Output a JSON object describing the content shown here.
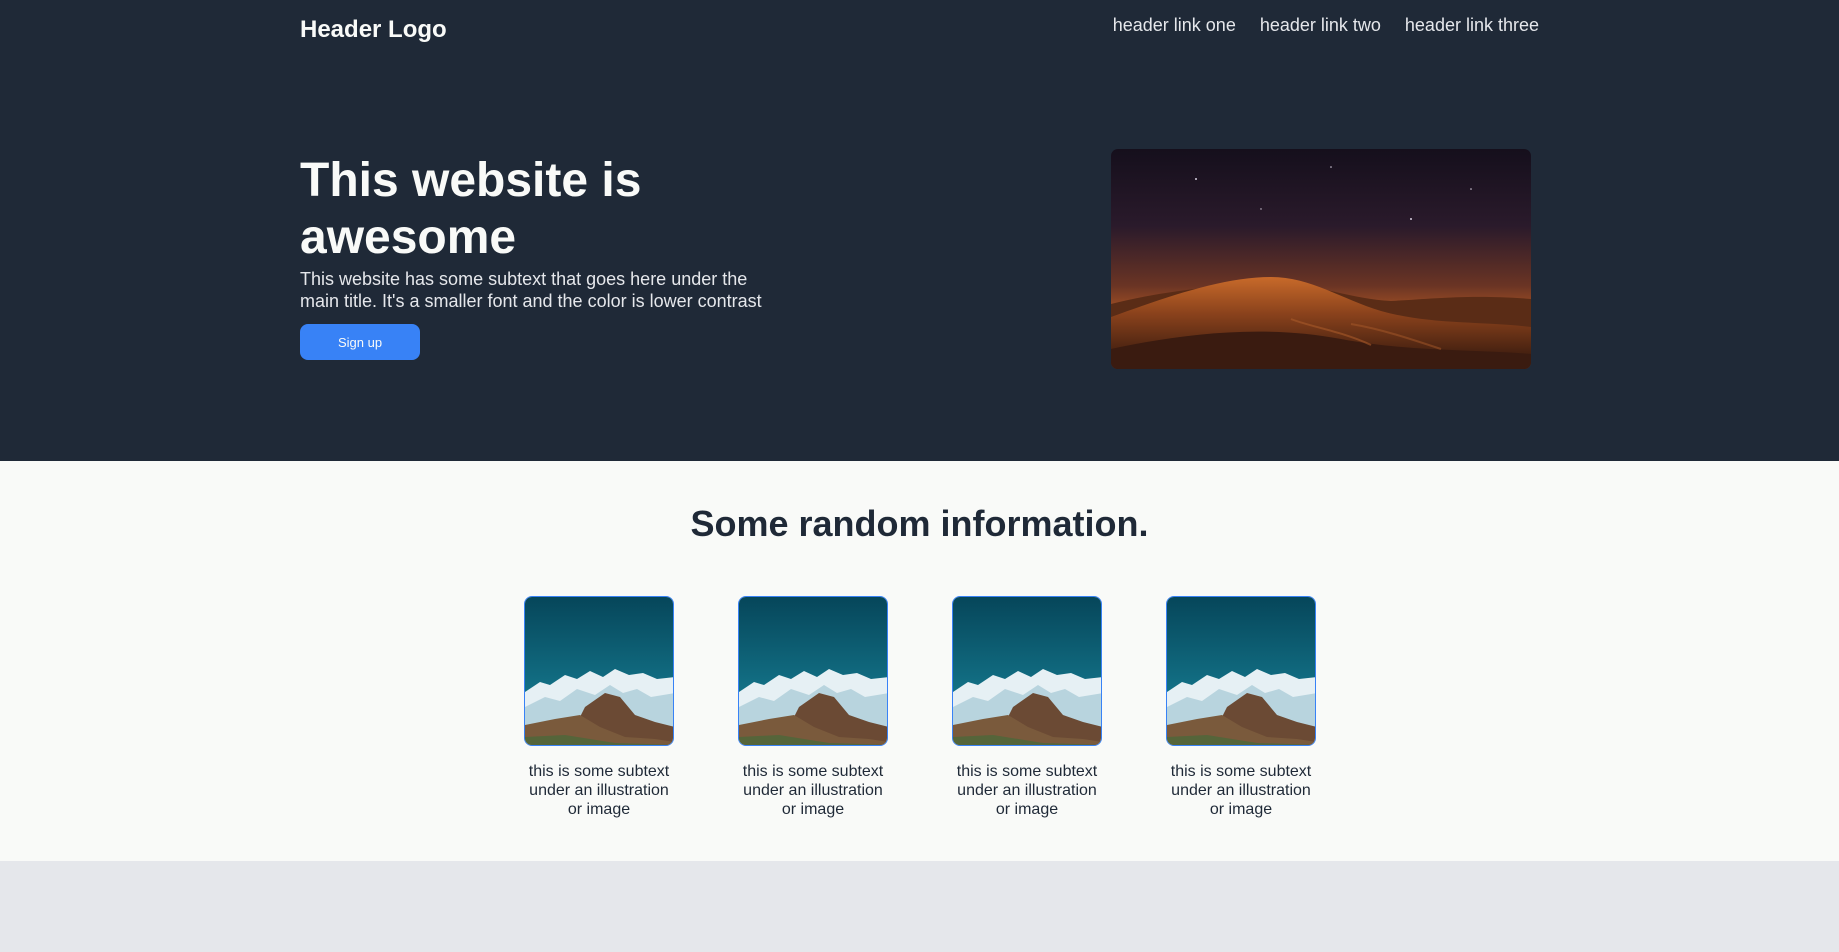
{
  "header": {
    "logo": "Header Logo",
    "links": [
      "header link one",
      "header link two",
      "header link three"
    ]
  },
  "hero": {
    "title": "This website is awesome",
    "subtext": "This website has some subtext that goes here under the main title. It's a smaller font and the color is lower contrast",
    "button_label": "Sign up",
    "image": "desert-dunes-night-image"
  },
  "info": {
    "title": "Some random information.",
    "cards": [
      {
        "image": "snowy-mountain-image",
        "caption": "this is some subtext under an illustration or image"
      },
      {
        "image": "snowy-mountain-image",
        "caption": "this is some subtext under an illustration or image"
      },
      {
        "image": "snowy-mountain-image",
        "caption": "this is some subtext under an illustration or image"
      },
      {
        "image": "snowy-mountain-image",
        "caption": "this is some subtext under an illustration or image"
      }
    ]
  },
  "colors": {
    "dark_bg": "#1f2937",
    "light_bg": "#f9faf8",
    "accent": "#3882f6",
    "muted_bg": "#e5e7eb"
  }
}
